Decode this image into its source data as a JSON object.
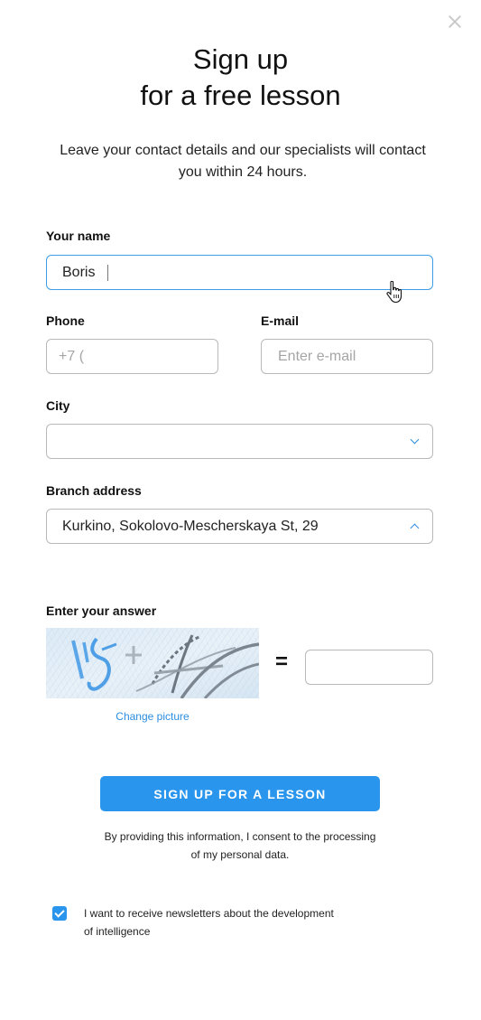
{
  "header": {
    "title_line1": "Sign up",
    "title_line2": "for a free lesson",
    "subtitle_line1": "Leave your contact details and our specialists will contact",
    "subtitle_line2": "you within 24 hours."
  },
  "form": {
    "name": {
      "label": "Your name",
      "value": "Boris"
    },
    "phone": {
      "label": "Phone",
      "placeholder": "+7 ("
    },
    "email": {
      "label": "E-mail",
      "placeholder": "Enter e-mail"
    },
    "city": {
      "label": "City",
      "value": ""
    },
    "branch": {
      "label": "Branch address",
      "value": "Kurkino, Sokolovo-Mescherskaya St, 29"
    },
    "captcha": {
      "label": "Enter your answer",
      "equals": "=",
      "change_label": "Change picture"
    },
    "submit_label": "SIGN UP FOR A LESSON",
    "consent_line1": "By providing this information, I consent to the processing",
    "consent_line2": "of my personal data.",
    "newsletter": {
      "checked": true,
      "line1": "I want to receive newsletters about the development",
      "line2": "of intelligence"
    }
  },
  "colors": {
    "accent": "#2a95ec",
    "focus_border": "#3f9ce6",
    "field_border": "#b9b9b9",
    "placeholder": "#a5a5a5"
  },
  "icons": [
    "close-icon",
    "chevron-down-icon",
    "chevron-up-icon",
    "hand-cursor-icon",
    "checkmark-icon"
  ]
}
